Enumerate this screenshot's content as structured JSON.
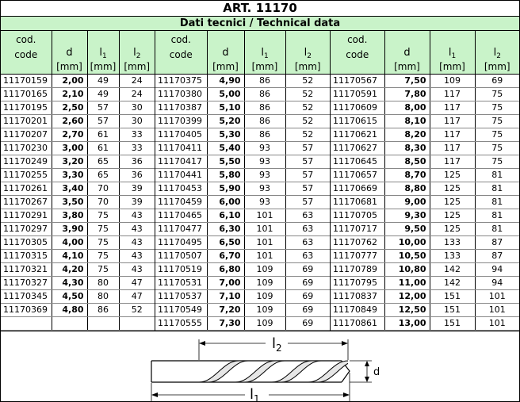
{
  "header": {
    "article": "ART. 11170",
    "subtitle": "Dati tecnici / Technical data"
  },
  "columns": {
    "code_it": "cod.",
    "code_en": "code",
    "d": "d",
    "l1_main": "l",
    "l1_sub": "1",
    "l2_main": "l",
    "l2_sub": "2",
    "unit": "[mm]"
  },
  "blocks": [
    {
      "rows": [
        {
          "code": "11170159",
          "d": "2,00",
          "l1": "49",
          "l2": "24"
        },
        {
          "code": "11170165",
          "d": "2,10",
          "l1": "49",
          "l2": "24"
        },
        {
          "code": "11170195",
          "d": "2,50",
          "l1": "57",
          "l2": "30"
        },
        {
          "code": "11170201",
          "d": "2,60",
          "l1": "57",
          "l2": "30"
        },
        {
          "code": "11170207",
          "d": "2,70",
          "l1": "61",
          "l2": "33"
        },
        {
          "code": "11170230",
          "d": "3,00",
          "l1": "61",
          "l2": "33"
        },
        {
          "code": "11170249",
          "d": "3,20",
          "l1": "65",
          "l2": "36"
        },
        {
          "code": "11170255",
          "d": "3,30",
          "l1": "65",
          "l2": "36"
        },
        {
          "code": "11170261",
          "d": "3,40",
          "l1": "70",
          "l2": "39"
        },
        {
          "code": "11170267",
          "d": "3,50",
          "l1": "70",
          "l2": "39"
        },
        {
          "code": "11170291",
          "d": "3,80",
          "l1": "75",
          "l2": "43"
        },
        {
          "code": "11170297",
          "d": "3,90",
          "l1": "75",
          "l2": "43"
        },
        {
          "code": "11170305",
          "d": "4,00",
          "l1": "75",
          "l2": "43"
        },
        {
          "code": "11170315",
          "d": "4,10",
          "l1": "75",
          "l2": "43"
        },
        {
          "code": "11170321",
          "d": "4,20",
          "l1": "75",
          "l2": "43"
        },
        {
          "code": "11170327",
          "d": "4,30",
          "l1": "80",
          "l2": "47"
        },
        {
          "code": "11170345",
          "d": "4,50",
          "l1": "80",
          "l2": "47"
        },
        {
          "code": "11170369",
          "d": "4,80",
          "l1": "86",
          "l2": "52"
        },
        {
          "code": "",
          "d": "",
          "l1": "",
          "l2": ""
        }
      ]
    },
    {
      "rows": [
        {
          "code": "11170375",
          "d": "4,90",
          "l1": "86",
          "l2": "52"
        },
        {
          "code": "11170380",
          "d": "5,00",
          "l1": "86",
          "l2": "52"
        },
        {
          "code": "11170387",
          "d": "5,10",
          "l1": "86",
          "l2": "52"
        },
        {
          "code": "11170399",
          "d": "5,20",
          "l1": "86",
          "l2": "52"
        },
        {
          "code": "11170405",
          "d": "5,30",
          "l1": "86",
          "l2": "52"
        },
        {
          "code": "11170411",
          "d": "5,40",
          "l1": "93",
          "l2": "57"
        },
        {
          "code": "11170417",
          "d": "5,50",
          "l1": "93",
          "l2": "57"
        },
        {
          "code": "11170441",
          "d": "5,80",
          "l1": "93",
          "l2": "57"
        },
        {
          "code": "11170453",
          "d": "5,90",
          "l1": "93",
          "l2": "57"
        },
        {
          "code": "11170459",
          "d": "6,00",
          "l1": "93",
          "l2": "57"
        },
        {
          "code": "11170465",
          "d": "6,10",
          "l1": "101",
          "l2": "63"
        },
        {
          "code": "11170477",
          "d": "6,30",
          "l1": "101",
          "l2": "63"
        },
        {
          "code": "11170495",
          "d": "6,50",
          "l1": "101",
          "l2": "63"
        },
        {
          "code": "11170507",
          "d": "6,70",
          "l1": "101",
          "l2": "63"
        },
        {
          "code": "11170519",
          "d": "6,80",
          "l1": "109",
          "l2": "69"
        },
        {
          "code": "11170531",
          "d": "7,00",
          "l1": "109",
          "l2": "69"
        },
        {
          "code": "11170537",
          "d": "7,10",
          "l1": "109",
          "l2": "69"
        },
        {
          "code": "11170549",
          "d": "7,20",
          "l1": "109",
          "l2": "69"
        },
        {
          "code": "11170555",
          "d": "7,30",
          "l1": "109",
          "l2": "69"
        }
      ]
    },
    {
      "rows": [
        {
          "code": "11170567",
          "d": "7,50",
          "l1": "109",
          "l2": "69"
        },
        {
          "code": "11170591",
          "d": "7,80",
          "l1": "117",
          "l2": "75"
        },
        {
          "code": "11170609",
          "d": "8,00",
          "l1": "117",
          "l2": "75"
        },
        {
          "code": "11170615",
          "d": "8,10",
          "l1": "117",
          "l2": "75"
        },
        {
          "code": "11170621",
          "d": "8,20",
          "l1": "117",
          "l2": "75"
        },
        {
          "code": "11170627",
          "d": "8,30",
          "l1": "117",
          "l2": "75"
        },
        {
          "code": "11170645",
          "d": "8,50",
          "l1": "117",
          "l2": "75"
        },
        {
          "code": "11170657",
          "d": "8,70",
          "l1": "125",
          "l2": "81"
        },
        {
          "code": "11170669",
          "d": "8,80",
          "l1": "125",
          "l2": "81"
        },
        {
          "code": "11170681",
          "d": "9,00",
          "l1": "125",
          "l2": "81"
        },
        {
          "code": "11170705",
          "d": "9,30",
          "l1": "125",
          "l2": "81"
        },
        {
          "code": "11170717",
          "d": "9,50",
          "l1": "125",
          "l2": "81"
        },
        {
          "code": "11170762",
          "d": "10,00",
          "l1": "133",
          "l2": "87"
        },
        {
          "code": "11170777",
          "d": "10,50",
          "l1": "133",
          "l2": "87"
        },
        {
          "code": "11170789",
          "d": "10,80",
          "l1": "142",
          "l2": "94"
        },
        {
          "code": "11170795",
          "d": "11,00",
          "l1": "142",
          "l2": "94"
        },
        {
          "code": "11170837",
          "d": "12,00",
          "l1": "151",
          "l2": "101"
        },
        {
          "code": "11170849",
          "d": "12,50",
          "l1": "151",
          "l2": "101"
        },
        {
          "code": "11170861",
          "d": "13,00",
          "l1": "151",
          "l2": "101"
        }
      ]
    }
  ],
  "diagram": {
    "label_l2_main": "l",
    "label_l2_sub": "2",
    "label_l1_main": "l",
    "label_l1_sub": "1",
    "label_d": "d"
  },
  "colors": {
    "header_green": "#c9f3c9"
  }
}
